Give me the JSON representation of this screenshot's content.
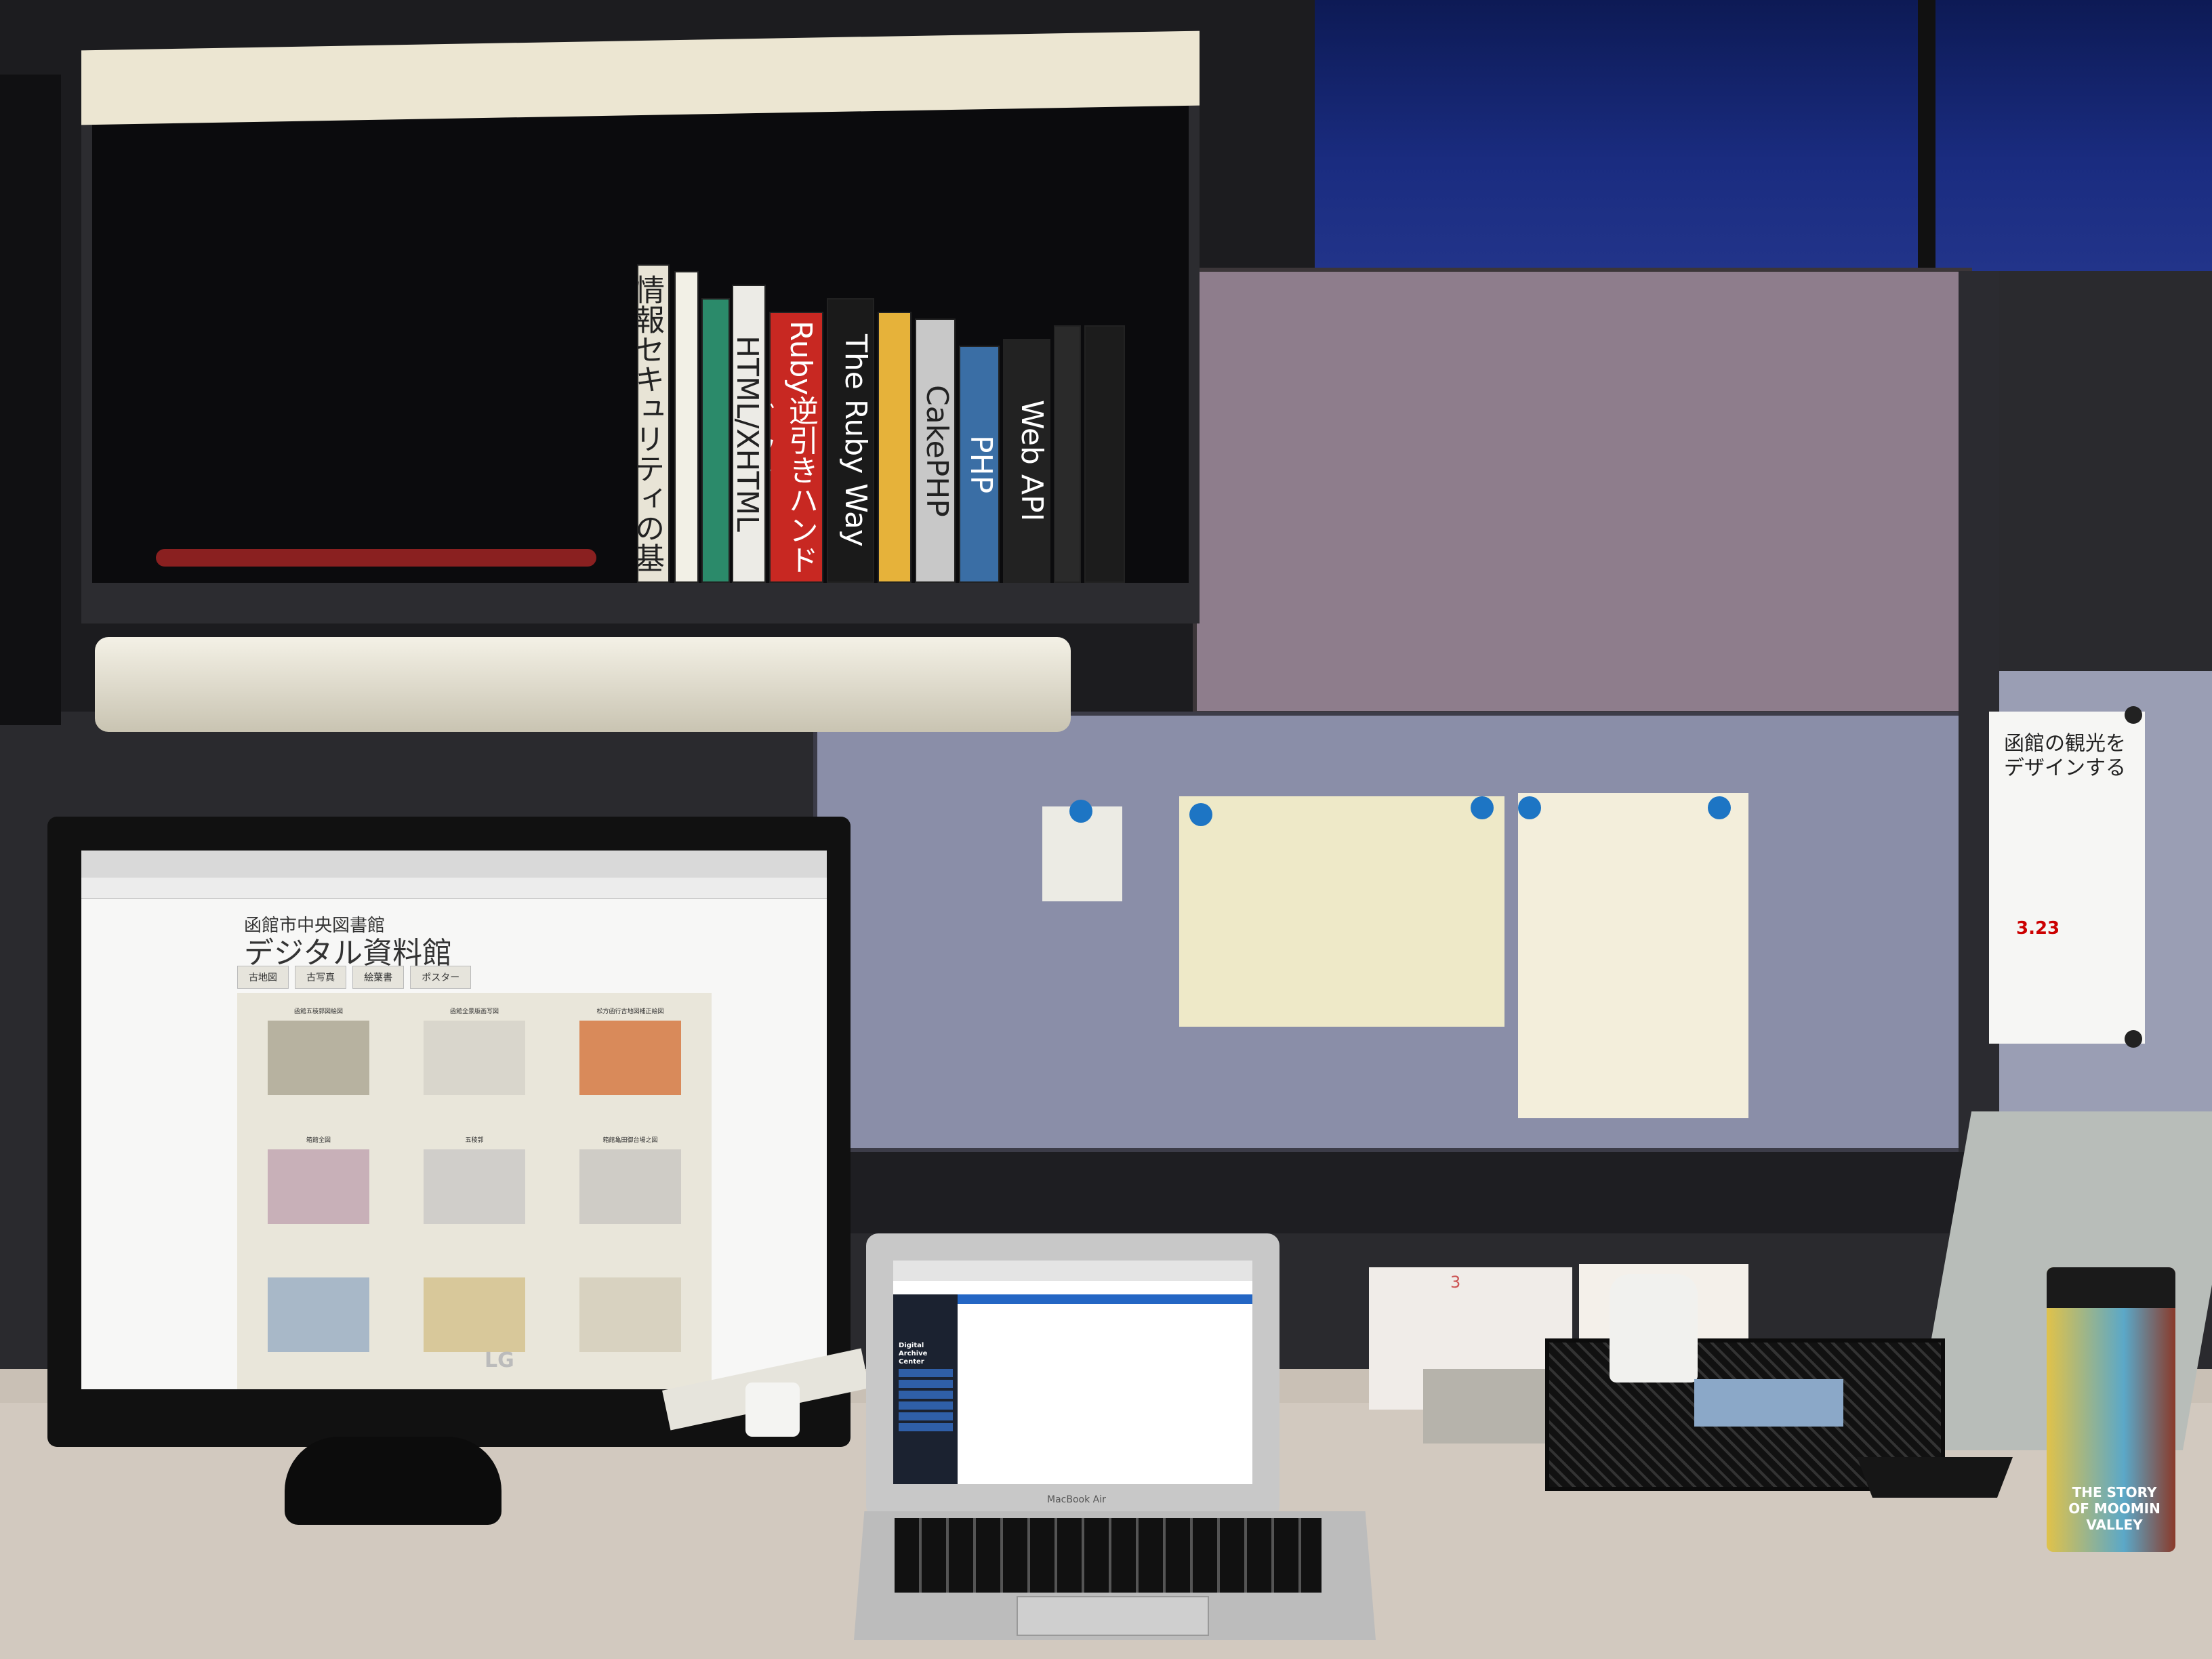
{
  "scene": {
    "monitor": {
      "brand": "LG",
      "site": {
        "title": "函館市中央図書館",
        "subtitle": "デジタル資料館",
        "nav_tabs": [
          "古地図",
          "古写真",
          "絵葉書",
          "ポスター"
        ],
        "thumbnails": [
          "函館五稜郭図絵図",
          "函館全景版画写図",
          "松方函行古地図補正絵図",
          "箱館全図",
          "五稜郭",
          "箱館亀田御台場之図",
          "",
          "",
          ""
        ]
      }
    },
    "books": [
      "情報セキュリティの基礎",
      "HTML/XHTML",
      "Ruby逆引きハンドブック",
      "The Ruby Way",
      "CakePHP",
      "Web API",
      "PHP"
    ],
    "laptop": {
      "label": "MacBook Air",
      "sidebar_title": "Digital Archive Center",
      "sidebar_items": [
        "",
        "",
        "",
        "",
        "",
        ""
      ]
    },
    "poster": {
      "title": "函館の観光をデザインする",
      "date": "3.23"
    },
    "calendar": {
      "month": "3"
    },
    "tumbler": {
      "text": "THE STORY OF MOOMIN VALLEY"
    }
  }
}
